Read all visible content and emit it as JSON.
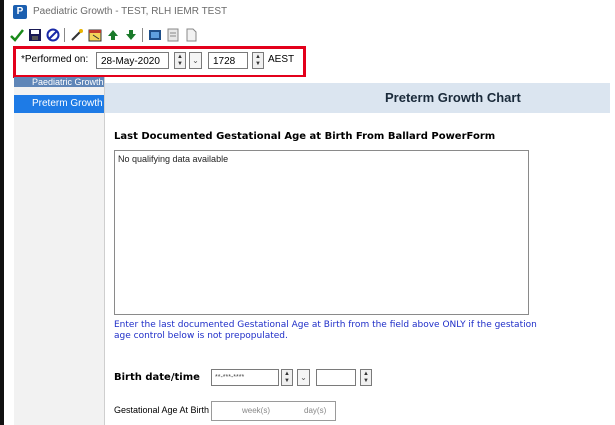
{
  "window": {
    "title": "Paediatric Growth - TEST, RLH IEMR TEST",
    "app_icon_letter": "P"
  },
  "toolbar": {
    "icons": [
      "checkmark-icon",
      "save-icon",
      "cancel-icon",
      "wand-icon",
      "calendar-icon",
      "up-arrow-icon",
      "down-arrow-icon",
      "display-icon",
      "notes-icon",
      "document-icon"
    ]
  },
  "performed": {
    "label": "*Performed on:",
    "date": "28-May-2020",
    "time": "1728",
    "timezone": "AEST",
    "highlight_color": "#e3001b"
  },
  "sidebar": {
    "items": [
      {
        "label": "Paediatric Growth"
      },
      {
        "label": "Preterm Growth C"
      }
    ]
  },
  "main": {
    "heading": "Preterm Growth Chart",
    "section_label": "Last Documented Gestational Age at Birth From Ballard PowerForm",
    "box_text": "No qualifying data available",
    "instruction": "Enter the last documented Gestational Age at Birth from the field above ONLY if the gestation age control below is not prepopulated.",
    "birth_label": "Birth date/time",
    "birth_date_placeholder": "**-***-****",
    "ga_label": "Gestational Age At Birth",
    "ga_week_placeholder": "week(s)",
    "ga_day_placeholder": "day(s)"
  },
  "colors": {
    "accent_blue": "#1e7be6",
    "heading_bg": "#dbe5f0",
    "instruction_text": "#1f2ec8"
  }
}
